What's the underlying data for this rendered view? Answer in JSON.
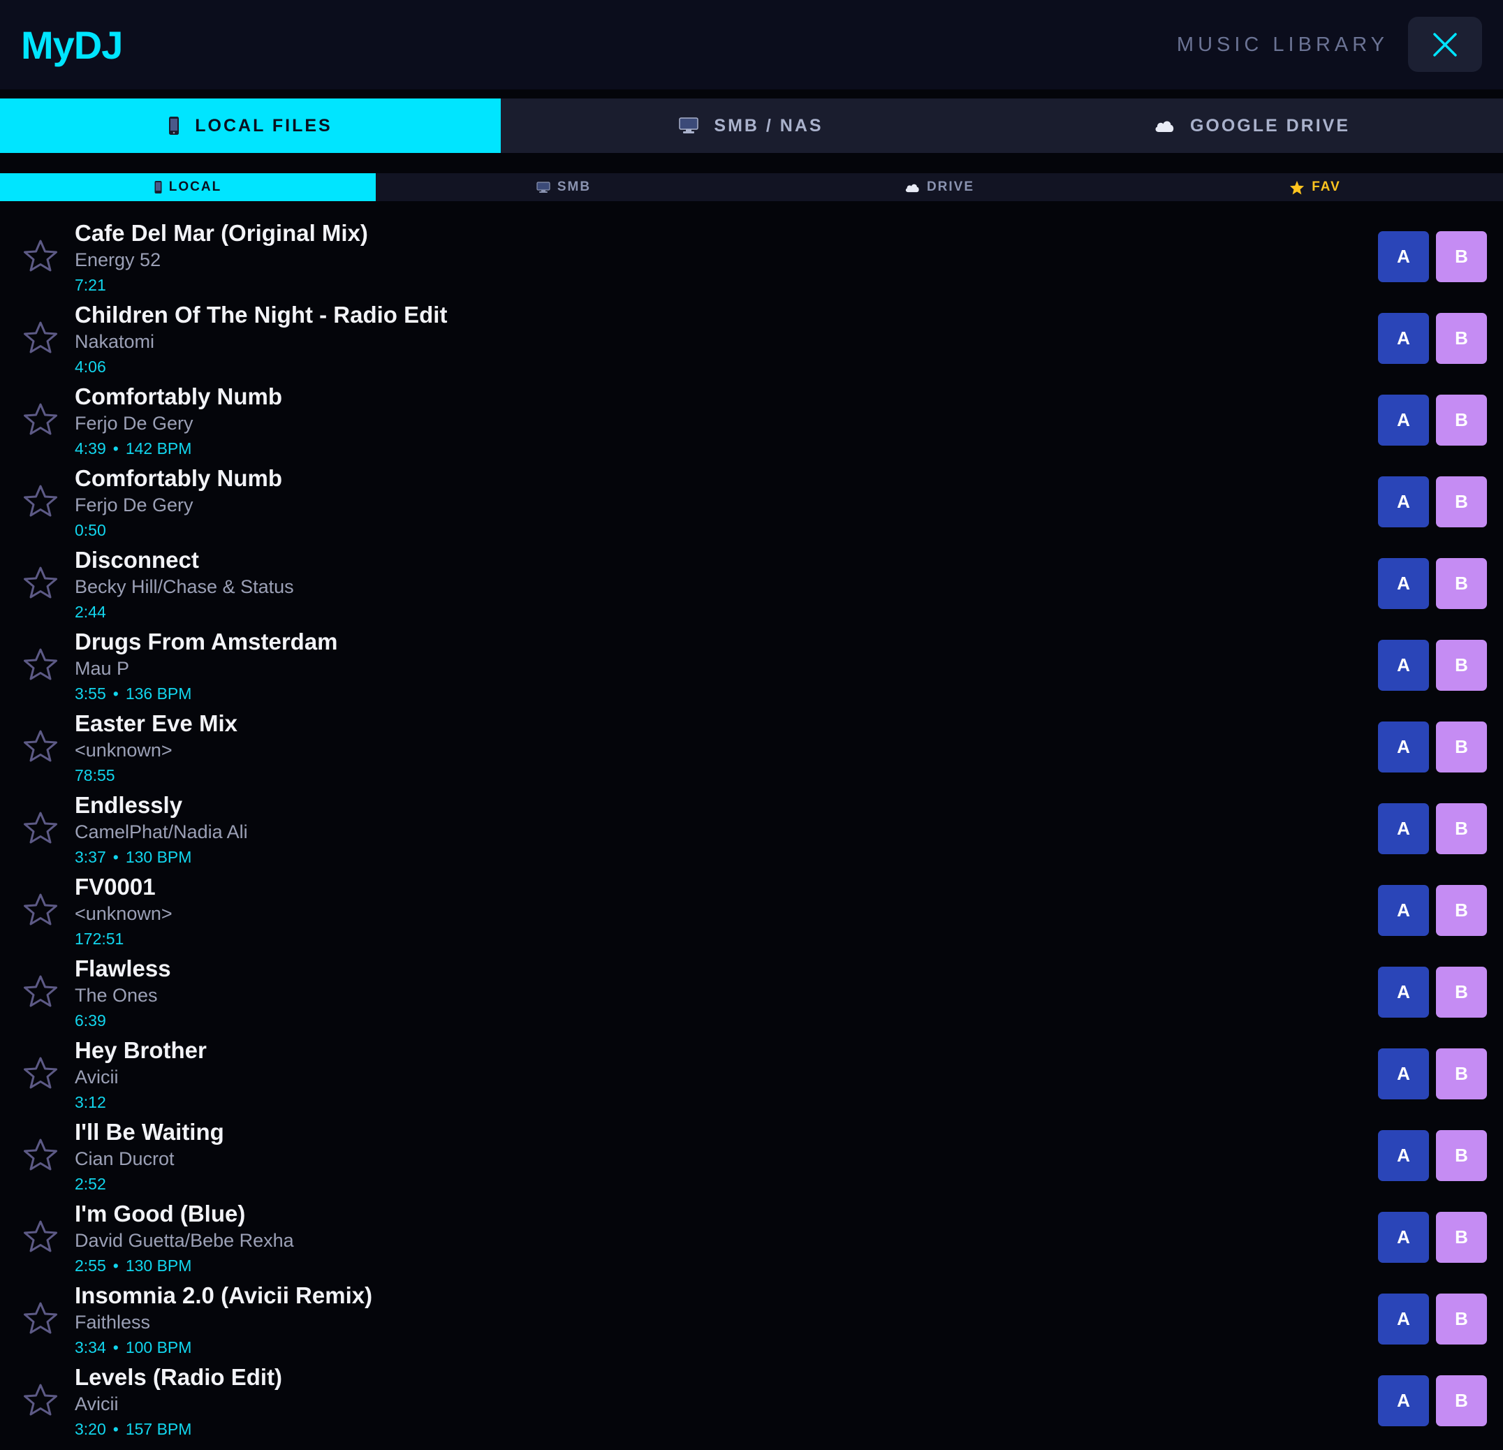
{
  "app": {
    "title": "MyDJ",
    "section_title": "MUSIC LIBRARY"
  },
  "colors": {
    "accent": "#00e5ff",
    "deck_a": "#2a45b8",
    "deck_b": "#c58cf3",
    "fav": "#ffc41f"
  },
  "main_tabs": [
    {
      "label": "LOCAL FILES",
      "icon": "phone-icon",
      "active": true
    },
    {
      "label": "SMB / NAS",
      "icon": "monitor-icon",
      "active": false
    },
    {
      "label": "GOOGLE DRIVE",
      "icon": "cloud-icon",
      "active": false
    }
  ],
  "sub_tabs": [
    {
      "label": "LOCAL",
      "icon": "phone-icon",
      "active": true
    },
    {
      "label": "SMB",
      "icon": "monitor-icon",
      "active": false
    },
    {
      "label": "DRIVE",
      "icon": "cloud-icon",
      "active": false
    },
    {
      "label": "FAV",
      "icon": "star-icon",
      "active": false
    }
  ],
  "deck_labels": {
    "a": "A",
    "b": "B"
  },
  "meta_separator": "•",
  "tracks": [
    {
      "title": "Cafe Del Mar (Original Mix)",
      "artist": "Energy 52",
      "duration": "7:21",
      "bpm": ""
    },
    {
      "title": "Children Of The Night - Radio Edit",
      "artist": "Nakatomi",
      "duration": "4:06",
      "bpm": ""
    },
    {
      "title": "Comfortably Numb",
      "artist": "Ferjo De Gery",
      "duration": "4:39",
      "bpm": "142 BPM"
    },
    {
      "title": "Comfortably Numb",
      "artist": "Ferjo De Gery",
      "duration": "0:50",
      "bpm": ""
    },
    {
      "title": "Disconnect",
      "artist": "Becky Hill/Chase & Status",
      "duration": "2:44",
      "bpm": ""
    },
    {
      "title": "Drugs From Amsterdam",
      "artist": "Mau P",
      "duration": "3:55",
      "bpm": "136 BPM"
    },
    {
      "title": "Easter Eve Mix",
      "artist": "<unknown>",
      "duration": "78:55",
      "bpm": ""
    },
    {
      "title": "Endlessly",
      "artist": "CamelPhat/Nadia Ali",
      "duration": "3:37",
      "bpm": "130 BPM"
    },
    {
      "title": "FV0001",
      "artist": "<unknown>",
      "duration": "172:51",
      "bpm": ""
    },
    {
      "title": "Flawless",
      "artist": "The Ones",
      "duration": "6:39",
      "bpm": ""
    },
    {
      "title": "Hey Brother",
      "artist": "Avicii",
      "duration": "3:12",
      "bpm": ""
    },
    {
      "title": "I'll Be Waiting",
      "artist": "Cian Ducrot",
      "duration": "2:52",
      "bpm": ""
    },
    {
      "title": "I'm Good (Blue)",
      "artist": "David Guetta/Bebe Rexha",
      "duration": "2:55",
      "bpm": "130 BPM"
    },
    {
      "title": "Insomnia 2.0 (Avicii Remix)",
      "artist": "Faithless",
      "duration": "3:34",
      "bpm": "100 BPM"
    },
    {
      "title": "Levels (Radio Edit)",
      "artist": "Avicii",
      "duration": "3:20",
      "bpm": "157 BPM"
    }
  ]
}
